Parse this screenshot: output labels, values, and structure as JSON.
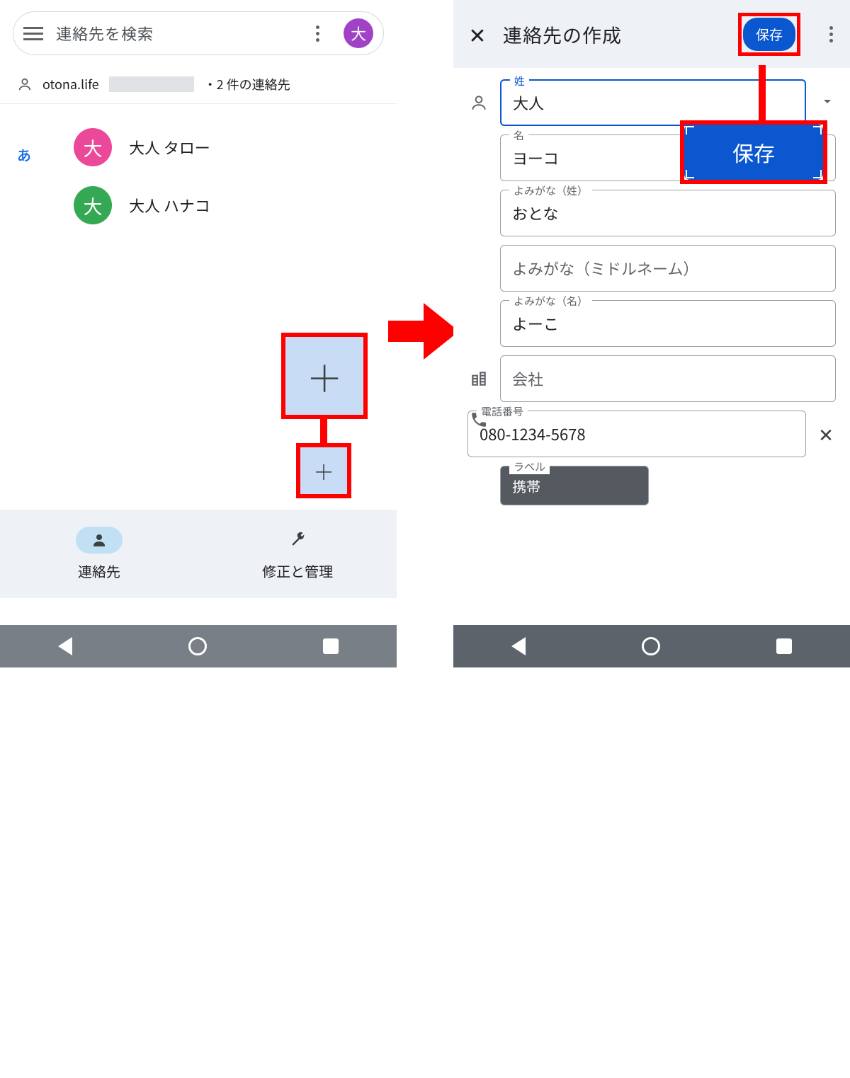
{
  "left": {
    "search_placeholder": "連絡先を検索",
    "avatar_letter": "大",
    "account_name": "otona.life",
    "account_count": "・2 件の連絡先",
    "section_letter": "あ",
    "contacts": [
      {
        "letter": "大",
        "name": "大人 タロー"
      },
      {
        "letter": "大",
        "name": "大人 ハナコ"
      }
    ],
    "tab_contacts": "連絡先",
    "tab_manage": "修正と管理"
  },
  "right": {
    "title": "連絡先の作成",
    "save_label": "保存",
    "save_callout": "保存",
    "fields": {
      "lastname_label": "姓",
      "lastname_value": "大人",
      "firstname_label": "名",
      "firstname_value": "ヨーコ",
      "phonetic_last_label": "よみがな（姓）",
      "phonetic_last_value": "おとな",
      "phonetic_middle_ph": "よみがな（ミドルネーム）",
      "phonetic_first_label": "よみがな（名）",
      "phonetic_first_value": "よーこ",
      "company_ph": "会社",
      "phone_label": "電話番号",
      "phone_value": "080-1234-5678",
      "typelabel_label": "ラベル",
      "typelabel_value": "携帯"
    }
  }
}
